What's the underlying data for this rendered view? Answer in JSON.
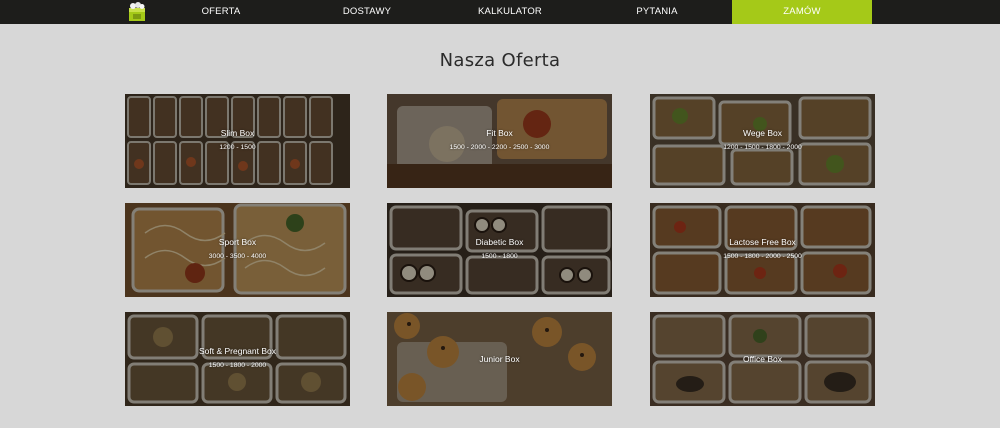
{
  "nav": {
    "logo_icon": "boxed-food-logo-icon",
    "items": [
      "OFERTA",
      "DOSTAWY",
      "KALKULATOR",
      "PYTANIA"
    ],
    "cta": "ZAMÓW",
    "accent_color": "#a5c918"
  },
  "page": {
    "title": "Nasza Oferta"
  },
  "offers": [
    {
      "name": "Slim Box",
      "kcal": "1200 - 1500"
    },
    {
      "name": "Fit Box",
      "kcal": "1500 - 2000 - 2200 - 2500 - 3000"
    },
    {
      "name": "Wege Box",
      "kcal": "1200 - 1500 - 1800 - 2000"
    },
    {
      "name": "Sport Box",
      "kcal": "3000 - 3500 - 4000"
    },
    {
      "name": "Diabetic Box",
      "kcal": "1500 - 1800"
    },
    {
      "name": "Lactose Free Box",
      "kcal": "1500 - 1800 - 2000 - 2500"
    },
    {
      "name": "Soft & Pregnant Box",
      "kcal": "1500 - 1800 - 2000"
    },
    {
      "name": "Junior Box",
      "kcal": ""
    },
    {
      "name": "Office Box",
      "kcal": ""
    }
  ]
}
